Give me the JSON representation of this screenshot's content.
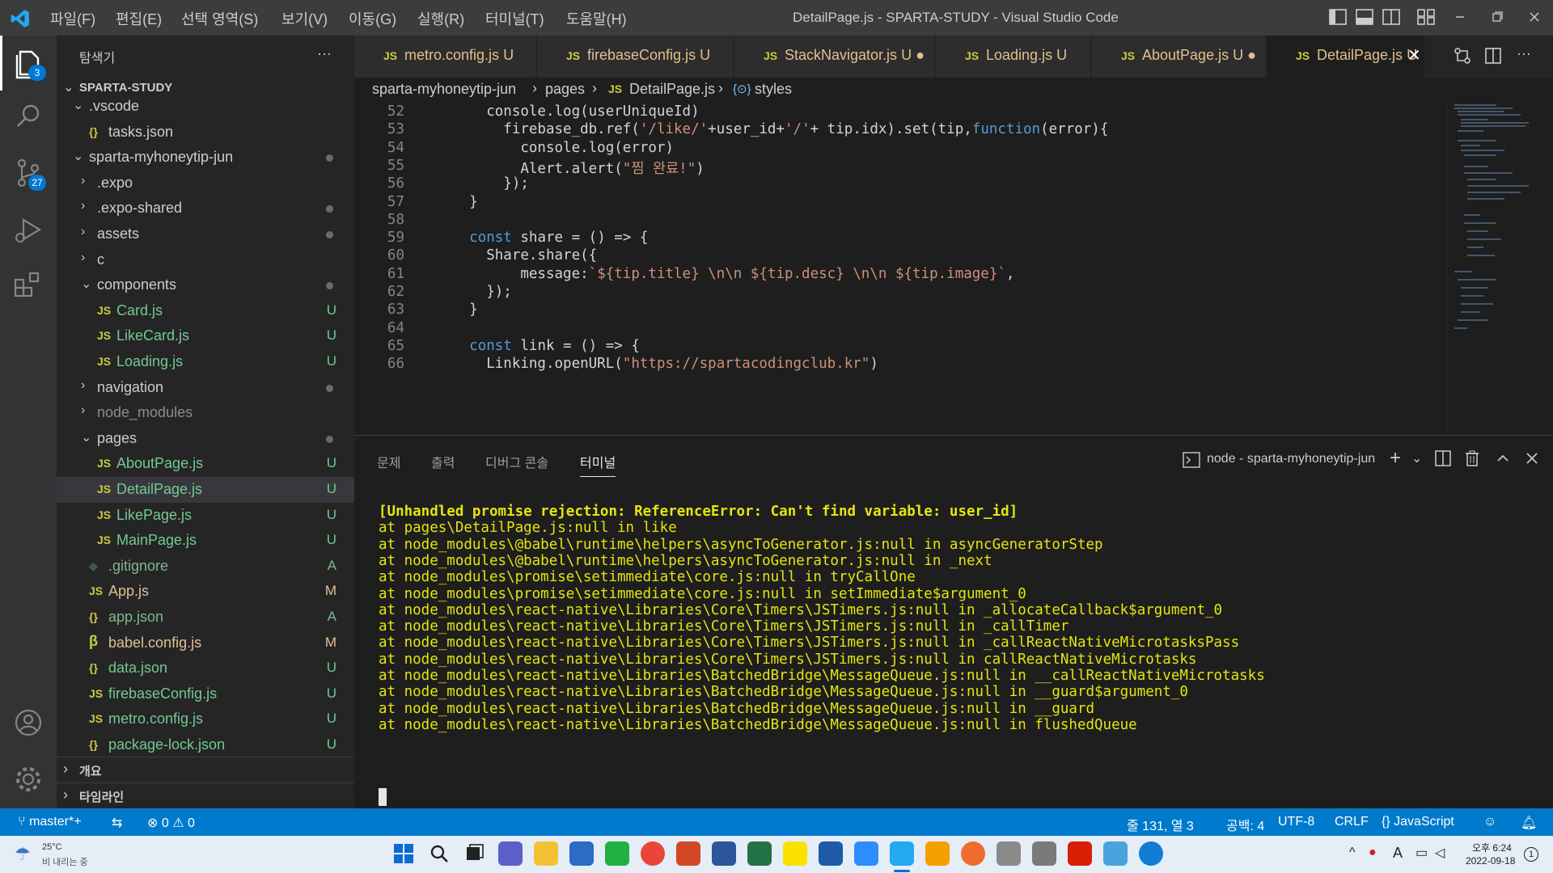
{
  "titlebar": {
    "menu": [
      "파일(F)",
      "편집(E)",
      "선택 영역(S)",
      "보기(V)",
      "이동(G)",
      "실행(R)",
      "터미널(T)",
      "도움말(H)"
    ],
    "title": "DetailPage.js - SPARTA-STUDY - Visual Studio Code"
  },
  "activity": {
    "explorer_badge": "3",
    "scm_badge": "27"
  },
  "sidebar": {
    "header": "탐색기",
    "more": "···",
    "root": "SPARTA-STUDY",
    "items": [
      {
        "label": ".vscode",
        "type": "folder-open",
        "indent": 1,
        "status": ""
      },
      {
        "label": "tasks.json",
        "type": "json",
        "indent": 2,
        "status": ""
      },
      {
        "label": "sparta-myhoneytip-jun",
        "type": "folder-open",
        "indent": 1,
        "status": "dot"
      },
      {
        "label": ".expo",
        "type": "folder",
        "indent": 2,
        "status": ""
      },
      {
        "label": ".expo-shared",
        "type": "folder",
        "indent": 2,
        "status": "dot"
      },
      {
        "label": "assets",
        "type": "folder",
        "indent": 2,
        "status": "dot"
      },
      {
        "label": "c",
        "type": "folder",
        "indent": 2,
        "status": ""
      },
      {
        "label": "components",
        "type": "folder-open",
        "indent": 2,
        "status": "dot"
      },
      {
        "label": "Card.js",
        "type": "js",
        "indent": 3,
        "status": "U"
      },
      {
        "label": "LikeCard.js",
        "type": "js",
        "indent": 3,
        "status": "U"
      },
      {
        "label": "Loading.js",
        "type": "js",
        "indent": 3,
        "status": "U"
      },
      {
        "label": "navigation",
        "type": "folder",
        "indent": 2,
        "status": "dot"
      },
      {
        "label": "node_modules",
        "type": "folder",
        "indent": 2,
        "status": ""
      },
      {
        "label": "pages",
        "type": "folder-open",
        "indent": 2,
        "status": "dot"
      },
      {
        "label": "AboutPage.js",
        "type": "js",
        "indent": 3,
        "status": "U"
      },
      {
        "label": "DetailPage.js",
        "type": "js",
        "indent": 3,
        "status": "U",
        "selected": true
      },
      {
        "label": "LikePage.js",
        "type": "js",
        "indent": 3,
        "status": "U"
      },
      {
        "label": "MainPage.js",
        "type": "js",
        "indent": 3,
        "status": "U"
      },
      {
        "label": ".gitignore",
        "type": "git",
        "indent": 2,
        "status": "A"
      },
      {
        "label": "App.js",
        "type": "js",
        "indent": 2,
        "status": "M"
      },
      {
        "label": "app.json",
        "type": "json",
        "indent": 2,
        "status": "A"
      },
      {
        "label": "babel.config.js",
        "type": "babel",
        "indent": 2,
        "status": "M"
      },
      {
        "label": "data.json",
        "type": "json",
        "indent": 2,
        "status": "U"
      },
      {
        "label": "firebaseConfig.js",
        "type": "js",
        "indent": 2,
        "status": "U"
      },
      {
        "label": "metro.config.js",
        "type": "js",
        "indent": 2,
        "status": "U"
      },
      {
        "label": "package-lock.json",
        "type": "json",
        "indent": 2,
        "status": "U"
      }
    ],
    "outline": "개요",
    "timeline": "타임라인"
  },
  "tabs": [
    {
      "label": "metro.config.js",
      "status": "U"
    },
    {
      "label": "firebaseConfig.js",
      "status": "U"
    },
    {
      "label": "StackNavigator.js",
      "status": "U ●"
    },
    {
      "label": "Loading.js",
      "status": "U"
    },
    {
      "label": "AboutPage.js",
      "status": "U ●"
    },
    {
      "label": "DetailPage.js",
      "status": "U",
      "active": true
    }
  ],
  "breadcrumb": [
    "sparta-myhoneytip-jun",
    "pages",
    "DetailPage.js",
    "styles"
  ],
  "editor": {
    "lines": [
      {
        "n": "52",
        "text": "      console.log(userUniqueId)"
      },
      {
        "n": "53",
        "text": "        firebase_db.ref('/like/'+user_id+'/'+ tip.idx).set(tip,function(error){"
      },
      {
        "n": "54",
        "text": "          console.log(error)"
      },
      {
        "n": "55",
        "text": "          Alert.alert(\"찜 완료!\")"
      },
      {
        "n": "56",
        "text": "        });"
      },
      {
        "n": "57",
        "text": "    }"
      },
      {
        "n": "58",
        "text": ""
      },
      {
        "n": "59",
        "text": "    const share = () => {"
      },
      {
        "n": "60",
        "text": "      Share.share({"
      },
      {
        "n": "61",
        "text": "          message:`${tip.title} \\n\\n ${tip.desc} \\n\\n ${tip.image}`,"
      },
      {
        "n": "62",
        "text": "      });"
      },
      {
        "n": "63",
        "text": "    }"
      },
      {
        "n": "64",
        "text": ""
      },
      {
        "n": "65",
        "text": "    const link = () => {"
      },
      {
        "n": "66",
        "text": "      Linking.openURL(\"https://spartacodingclub.kr\")"
      }
    ]
  },
  "panel": {
    "tabs": [
      "문제",
      "출력",
      "디버그 콘솔",
      "터미널"
    ],
    "terminal_name": "node - sparta-myhoneytip-jun",
    "lines": [
      "[Unhandled promise rejection: ReferenceError: Can't find variable: user_id]",
      "at pages\\DetailPage.js:null in like",
      "at node_modules\\@babel\\runtime\\helpers\\asyncToGenerator.js:null in asyncGeneratorStep",
      "at node_modules\\@babel\\runtime\\helpers\\asyncToGenerator.js:null in _next",
      "at node_modules\\promise\\setimmediate\\core.js:null in tryCallOne",
      "at node_modules\\promise\\setimmediate\\core.js:null in setImmediate$argument_0",
      "at node_modules\\react-native\\Libraries\\Core\\Timers\\JSTimers.js:null in _allocateCallback$argument_0",
      "at node_modules\\react-native\\Libraries\\Core\\Timers\\JSTimers.js:null in _callTimer",
      "at node_modules\\react-native\\Libraries\\Core\\Timers\\JSTimers.js:null in _callReactNativeMicrotasksPass",
      "at node_modules\\react-native\\Libraries\\Core\\Timers\\JSTimers.js:null in callReactNativeMicrotasks",
      "at node_modules\\react-native\\Libraries\\BatchedBridge\\MessageQueue.js:null in __callReactNativeMicrotasks",
      "at node_modules\\react-native\\Libraries\\BatchedBridge\\MessageQueue.js:null in __guard$argument_0",
      "at node_modules\\react-native\\Libraries\\BatchedBridge\\MessageQueue.js:null in __guard",
      "at node_modules\\react-native\\Libraries\\BatchedBridge\\MessageQueue.js:null in flushedQueue"
    ]
  },
  "status": {
    "branch": "master*+",
    "errors": "0",
    "warnings": "0",
    "position": "줄 131, 열 3",
    "spaces": "공백: 4",
    "encoding": "UTF-8",
    "eol": "CRLF",
    "language": "JavaScript"
  },
  "taskbar": {
    "temp": "25°C",
    "weather": "비 내리는 중",
    "time": "오후 6:24",
    "date": "2022-09-18",
    "notif": "1",
    "ime": "A"
  },
  "colors": {
    "accent": "#007acc",
    "modified": "#e2c08d",
    "added": "#81b88b",
    "terminal": "#e5e510"
  }
}
